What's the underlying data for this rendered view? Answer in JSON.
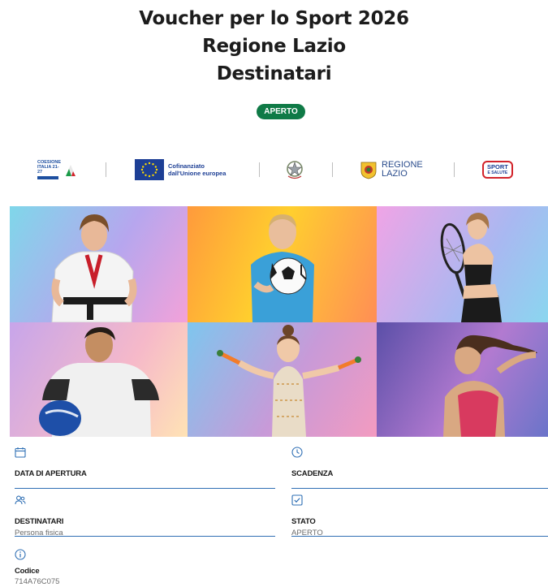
{
  "header": {
    "title_line1": "Voucher per lo Sport 2026",
    "title_line2": "Regione Lazio",
    "title_line3": "Destinatari",
    "status_badge": "APERTO"
  },
  "logos": {
    "coesione_text": "COESIONE ITALIA 21-27",
    "eu_text_line1": "Cofinanziato",
    "eu_text_line2": "dall'Unione europea",
    "lazio_line1": "REGIONE",
    "lazio_line2": "LAZIO",
    "sport_line1": "SPORT",
    "sport_line2": "E SALUTE"
  },
  "gallery": {
    "tiles": [
      "karate-girl",
      "football-boy",
      "tennis-girl",
      "american-football-player",
      "rhythmic-gymnast",
      "athlete-woman"
    ]
  },
  "details": {
    "opening_label": "DATA DI APERTURA",
    "opening_value": "",
    "deadline_label": "SCADENZA",
    "deadline_value": "",
    "recipients_label": "DESTINATARI",
    "recipients_value": "Persona fisica",
    "status_label": "STATO",
    "status_value": "APERTO",
    "code_label": "Codice",
    "code_value": "714A76C075"
  },
  "colors": {
    "badge_green": "#0f7a46",
    "accent_blue": "#2f6fb4",
    "eu_blue": "#1d3f95"
  }
}
